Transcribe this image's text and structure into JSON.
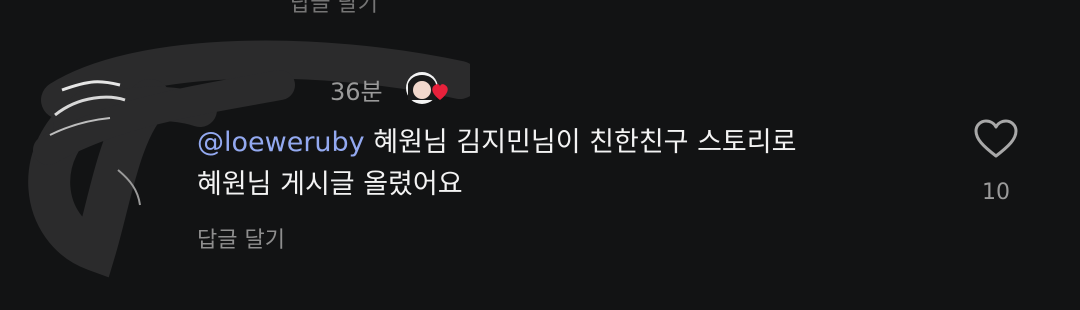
{
  "previous_reply": {
    "label": "답글 달기"
  },
  "comment": {
    "timestamp": "36분",
    "mention": "loeweruby",
    "mention_icon": "threads-at-icon",
    "text_line1": "혜원님 김지민님이 친한친구 스토리로",
    "text_line2": "혜원님 게시글 올렸어요",
    "reply_label": "답글 달기",
    "like_count": "10"
  },
  "colors": {
    "background": "#121314",
    "mention": "#93a9f0",
    "muted": "#8e8e8e",
    "heart_sticker": "#e8213b",
    "redaction": "#2a2a2b"
  }
}
